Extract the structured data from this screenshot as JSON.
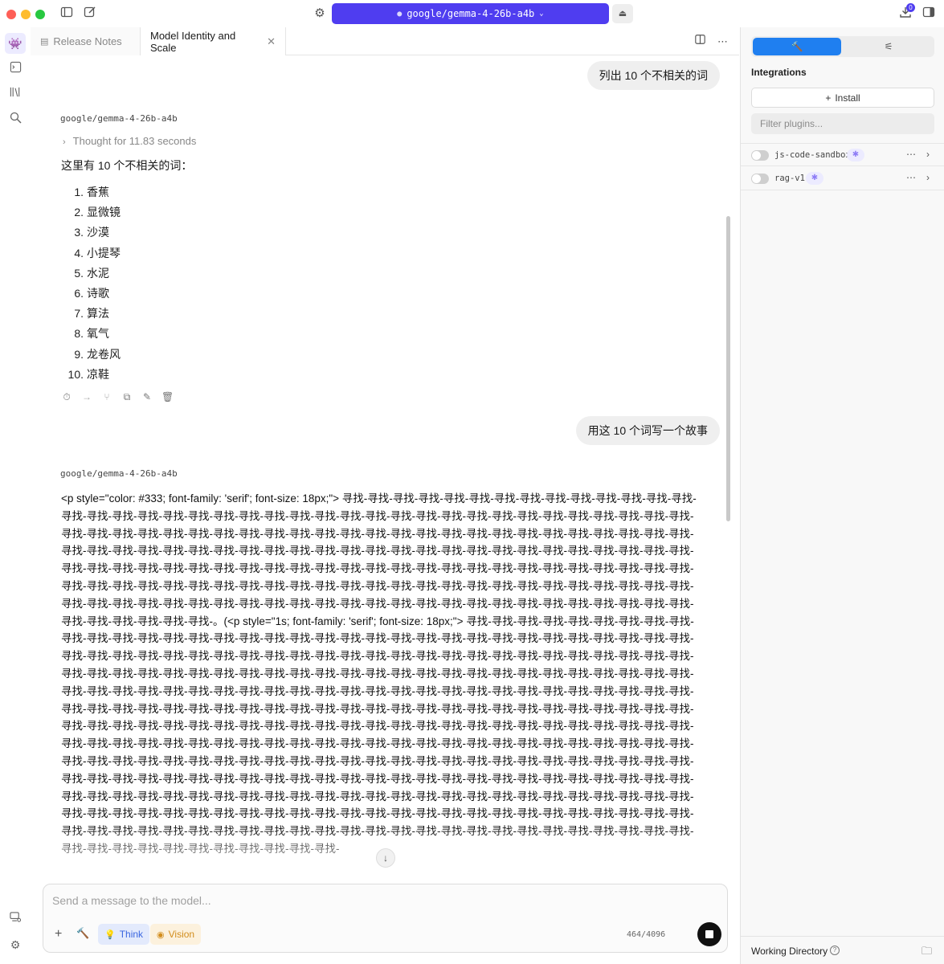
{
  "window": {
    "model_pill": "google/gemma-4-26b-a4b",
    "download_badge": "0",
    "colors": {
      "accent": "#4f3df0",
      "seg_active": "#1f7ff0",
      "traffic_red": "#fe5f57",
      "traffic_yellow": "#febc2e",
      "traffic_green": "#28c840"
    }
  },
  "tabs": [
    {
      "label": "Release Notes"
    },
    {
      "label": "Model Identity and Scale"
    }
  ],
  "chat": {
    "user_msg_1": "列出 10 个不相关的词",
    "model_name_1": "google/gemma-4-26b-a4b",
    "thought": "Thought for 11.83 seconds",
    "intro": "这里有 10 个不相关的词：",
    "list": [
      {
        "num": "1.",
        "text": "香蕉"
      },
      {
        "num": "2.",
        "text": "显微镜"
      },
      {
        "num": "3.",
        "text": "沙漠"
      },
      {
        "num": "4.",
        "text": "小提琴"
      },
      {
        "num": "5.",
        "text": "水泥"
      },
      {
        "num": "6.",
        "text": "诗歌"
      },
      {
        "num": "7.",
        "text": "算法"
      },
      {
        "num": "8.",
        "text": "氧气"
      },
      {
        "num": "9.",
        "text": "龙卷风"
      },
      {
        "num": "10.",
        "text": "凉鞋"
      }
    ],
    "user_msg_2": "用这 10 个词写一个故事",
    "model_name_2": "google/gemma-4-26b-a4b",
    "response_prefix_1": "<p style=\"color: #333; font-family: 'serif'; font-size: 18px;\"> ",
    "response_sep": "。(",
    "response_prefix_2": "<p style=\"1s; font-family: 'serif'; font-size: 18px;\"> ",
    "repeat_token": "寻找-"
  },
  "composer": {
    "placeholder": "Send a message to the model...",
    "think_label": "Think",
    "vision_label": "Vision",
    "token_count": "464/4096"
  },
  "panel": {
    "title": "Integrations",
    "install_label": "Install",
    "filter_placeholder": "Filter plugins...",
    "plugins": [
      {
        "name": "js-code-sandbox",
        "enabled": false
      },
      {
        "name": "rag-v1",
        "enabled": false
      }
    ],
    "working_directory": "Working Directory"
  },
  "icons": [
    "sidebar-toggle-icon",
    "compose-icon",
    "gear-icon",
    "eject-icon",
    "download-icon",
    "panel-toggle-icon",
    "robot-icon",
    "terminal-icon",
    "library-icon",
    "search-models-icon",
    "document-icon",
    "close-icon",
    "split-view-icon",
    "more-icon",
    "chevron-right-icon",
    "chevron-down-icon",
    "timer-icon",
    "continue-icon",
    "branch-icon",
    "copy-icon",
    "edit-icon",
    "trash-icon",
    "arrow-down-icon",
    "plus-icon",
    "hammer-icon",
    "lightbulb-icon",
    "eye-icon",
    "stop-icon",
    "sliders-icon",
    "puzzle-icon",
    "help-icon",
    "folder-icon",
    "server-icon"
  ]
}
